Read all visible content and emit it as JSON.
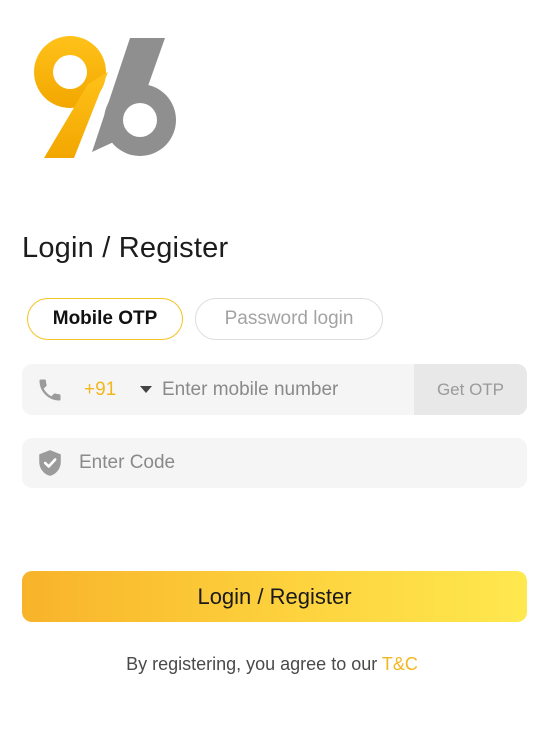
{
  "app": {
    "logo_icon": "96-logo-icon",
    "brand_colors": {
      "primary": "#f5b800",
      "secondary": "#8f8f8f"
    }
  },
  "login": {
    "title": "Login / Register",
    "tabs": [
      {
        "label": "Mobile OTP",
        "active": true
      },
      {
        "label": "Password login",
        "active": false
      }
    ],
    "phone": {
      "icon": "phone-icon",
      "country_code": "+91",
      "dropdown_icon": "caret-down-icon",
      "value": "",
      "placeholder": "Enter mobile number",
      "otp_button_label": "Get OTP"
    },
    "code": {
      "icon": "shield-check-icon",
      "value": "",
      "placeholder": "Enter Code"
    },
    "submit_label": "Login / Register",
    "terms": {
      "prefix": "By registering, you agree to our ",
      "link_label": "T&C"
    },
    "colors": {
      "accent": "#f3b61e",
      "button_gradient_start": "#f8b32a",
      "button_gradient_end": "#ffe84f"
    }
  }
}
